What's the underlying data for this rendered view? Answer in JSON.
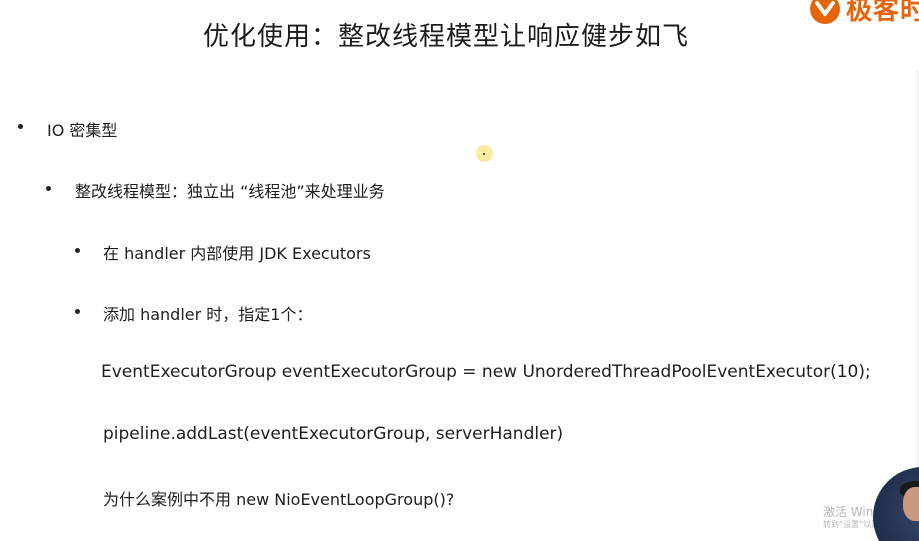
{
  "slide": {
    "title": "优化使用：整改线程模型让响应健步如飞",
    "logo_text": "极客时",
    "brand_color": "#e8640c",
    "items": [
      {
        "level": 1,
        "text": "IO 密集型"
      },
      {
        "level": 2,
        "text": "整改线程模型：独立出 “线程池”来处理业务"
      },
      {
        "level": 3,
        "text": "在 handler 内部使用 JDK Executors"
      },
      {
        "level": 3,
        "text": "添加 handler 时，指定1个："
      }
    ],
    "code_lines": [
      "EventExecutorGroup eventExecutorGroup = new UnorderedThreadPoolEventExecutor(10);",
      "pipeline.addLast(eventExecutorGroup, serverHandler)",
      "为什么案例中不用 new NioEventLoopGroup()?"
    ]
  },
  "overlay": {
    "watermark_title": "激活 Windows",
    "watermark_sub": "转到“设置”以激活 Windows"
  }
}
